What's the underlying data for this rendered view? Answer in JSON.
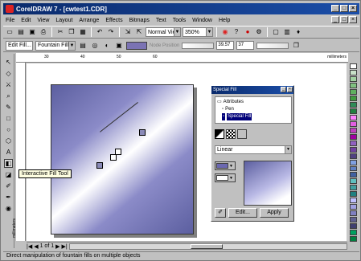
{
  "window": {
    "title": "CorelDRAW 7 - [cwtest1.CDR]",
    "controls": [
      "_",
      "□",
      "×"
    ]
  },
  "menu": [
    "File",
    "Edit",
    "View",
    "Layout",
    "Arrange",
    "Effects",
    "Bitmaps",
    "Text",
    "Tools",
    "Window",
    "Help"
  ],
  "toolbar": {
    "view_mode": "Normal View",
    "zoom": "350%"
  },
  "property_bar": {
    "edit_fill_label": "Edit Fill...",
    "fill_type": "Fountain Fill",
    "node_position_label": "Node Position",
    "angle_value": "39.57",
    "edge_value": "37"
  },
  "ruler": {
    "unit": "millimeters",
    "h_ticks": [
      "30",
      "40",
      "50",
      "60"
    ]
  },
  "tooltip": "Interactive Fill Tool",
  "docker": {
    "title": "Special Fill",
    "tree": [
      "Attributes",
      "Pen",
      "Special Fill"
    ],
    "fill_style": "Linear",
    "edit_button": "Edit...",
    "apply_button": "Apply",
    "colors": {
      "from": "#6b68b0",
      "to": "#ffffff"
    }
  },
  "page_nav": {
    "label": "1 of 1"
  },
  "status": "Direct manipulation of fountain fills on multiple objects",
  "palette": [
    "#ffffff",
    "#c8e0c8",
    "#a0d0a0",
    "#80c080",
    "#60b060",
    "#409a40",
    "#2e8b57",
    "#208040",
    "#ff80ff",
    "#e060e0",
    "#c040c0",
    "#a000a0",
    "#9060c0",
    "#7040a0",
    "#504080",
    "#80a0e0",
    "#6080c0",
    "#4060a0",
    "#60c0c0",
    "#40a0a0",
    "#208080",
    "#c0c0ff",
    "#a0a0e0",
    "#8080c0",
    "#606090",
    "#404070",
    "#00a060",
    "#008040"
  ]
}
